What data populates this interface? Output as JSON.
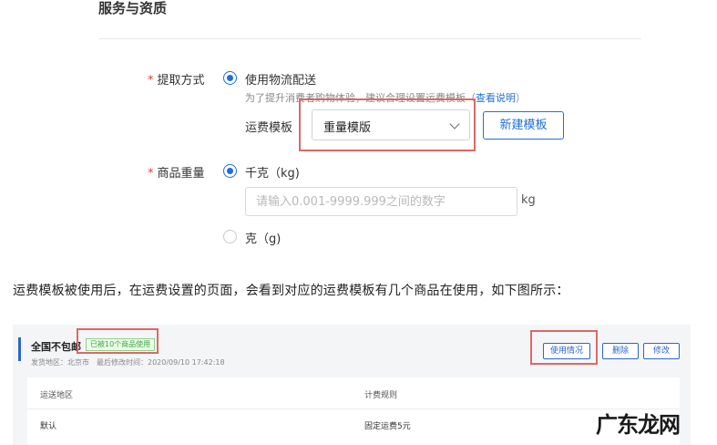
{
  "form": {
    "section_title": "服务与资质",
    "pickup": {
      "label": "提取方式",
      "required_mark": "*",
      "option_label": "使用物流配送",
      "hint": "为了提升消费者购物体验，建议合理设置运费模板（",
      "hint_link": "查看说明",
      "hint_end": "）",
      "template_label": "运费模板",
      "template_selected": "重量模版",
      "new_template_button": "新建模板"
    },
    "weight": {
      "label": "商品重量",
      "required_mark": "*",
      "option_kg": "千克（kg)",
      "input_placeholder": "请输入0.001-9999.999之间的数字",
      "unit": "kg",
      "option_g": "克（g)"
    }
  },
  "paragraph": "运费模板被使用后，在运费设置的页面，会看到对应的运费模板有几个商品在使用，如下图所示：",
  "card": {
    "title": "全国不包邮",
    "used_badge": "已被10个商品使用",
    "ship_from": "发货地区：北京市",
    "modified": "最后修改时间：2020/09/10 17:42:18",
    "buttons": {
      "usage": "使用情况",
      "delete": "删除",
      "edit": "修改"
    },
    "table": {
      "headers": [
        "运送地区",
        "计费规则"
      ],
      "row": [
        "默认",
        "固定运费5元"
      ]
    }
  },
  "watermark": "广东龙网",
  "colors": {
    "accent": "#1f6fd6",
    "required": "#e0433c",
    "highlight_box": "#d96a64",
    "badge_green": "#3aa83a"
  }
}
